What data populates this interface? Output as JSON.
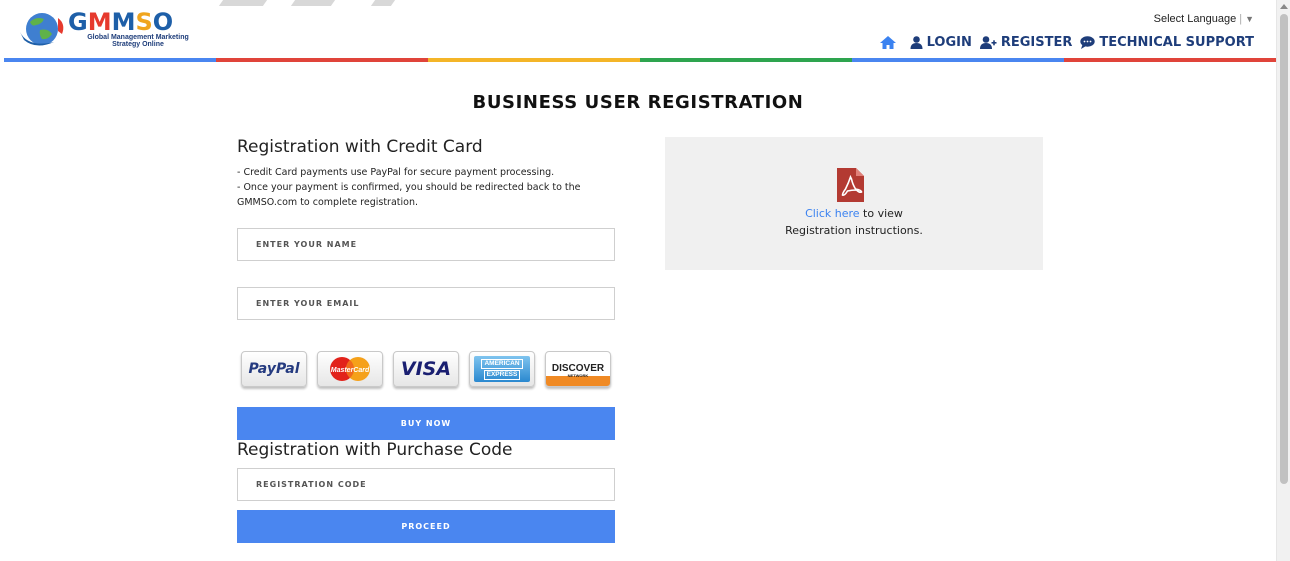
{
  "header": {
    "logo_text": "GMMSO",
    "logo_sub_line1": "Global Management Marketing",
    "logo_sub_line2": "Strategy Online",
    "language_label": "Select Language",
    "language_sep": "|",
    "language_arrow": "▼",
    "nav": {
      "login": "LOGIN",
      "register": "REGISTER",
      "support": "TECHNICAL SUPPORT"
    },
    "stripe_colors": [
      "#4a86f0",
      "#e0443a",
      "#f4b528",
      "#2ea44f",
      "#4a86f0",
      "#e0443a"
    ]
  },
  "page": {
    "title": "BUSINESS USER REGISTRATION"
  },
  "credit_card": {
    "heading": "Registration with Credit Card",
    "info_line1": "- Credit Card payments use PayPal for secure payment processing.",
    "info_line2": "- Once your payment is confirmed, you should be redirected back to the GMMSO.com to complete registration.",
    "name_placeholder": "ENTER YOUR NAME",
    "email_placeholder": "ENTER YOUR EMAIL",
    "cards": {
      "paypal": "PayPal",
      "mastercard": "MasterCard",
      "visa": "VISA",
      "amex_line1": "AMERICAN",
      "amex_line2": "EXPRESS",
      "discover": "DISCOVER",
      "discover_sub": "NETWORK"
    },
    "buy_button": "BUY NOW"
  },
  "purchase_code": {
    "heading": "Registration with Purchase Code",
    "code_placeholder": "REGISTRATION CODE",
    "proceed_button": "PROCEED"
  },
  "instructions": {
    "link_text": "Click here",
    "text_after_link": " to view",
    "line2": "Registration instructions."
  },
  "colors": {
    "accent_blue": "#4a86f0",
    "nav_text": "#1e3d7a",
    "pdf_red": "#b33a32"
  }
}
